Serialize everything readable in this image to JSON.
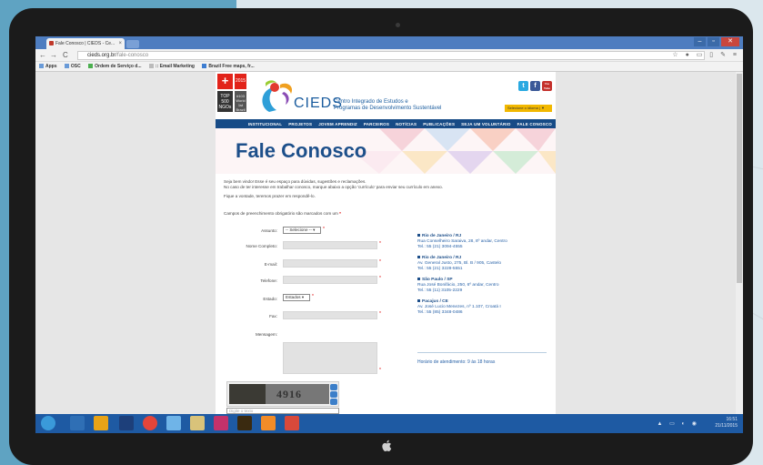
{
  "browser": {
    "tab_title": "Fale Conosco | CIEDS - Ce...",
    "url_domain": "cieds.org.br",
    "url_path": "/fale-conosco",
    "nav_back": "←",
    "nav_forward": "→",
    "nav_reload": "C",
    "window_min": "–",
    "window_max": "▫",
    "window_close": "✕",
    "toolbar_icons": "☆ ● ▭ ▯ ✎ ≡"
  },
  "bookmarks": [
    {
      "label": "Apps"
    },
    {
      "label": "OSC"
    },
    {
      "label": "Ordem de Serviço d..."
    },
    {
      "label": ":: Email Marketing"
    },
    {
      "label": "Brazil Free maps, fr..."
    }
  ],
  "site": {
    "badge_plus": "+",
    "badge_year": "2015",
    "badge_top": "TOP 500 NGOs",
    "badge_rank": "#103 World 1st Brazil",
    "logo_text": "CIEDS",
    "tagline_line1": "Centro Integrado de Estudos e",
    "tagline_line2": "Programas de Desenvolvimento Sustentável",
    "language_select": "Selecione o idioma | ▼",
    "social": [
      "t",
      "f",
      "You Tube"
    ],
    "menu": [
      "INSTITUCIONAL",
      "PROJETOS",
      "JOVEM APRENDIZ",
      "PARCEIROS",
      "NOTÍCIAS",
      "PUBLICAÇÕES",
      "SEJA UM VOLUNTÁRIO",
      "FALE CONOSCO"
    ],
    "page_title": "Fale Conosco",
    "intro_line1": "Seja bem vindo! Esse é seu espaço para dúvidas, sugestões e reclamações.",
    "intro_line2": "No caso de ter interesse em trabalhar conosco, marque abaixo a opção 'currículo' para enviar seu currículo em anexo.",
    "intro_line3": "Fique a vontade, teremos prazer em respondê-lo.",
    "required_note": "Campos de preenchimento obrigatório são marcados com um",
    "required_star": "*"
  },
  "form": {
    "assunto_label": "Assunto:",
    "assunto_value": "-- Selecione -- ▾",
    "nome_label": "Nome Completo:",
    "email_label": "E-mail:",
    "telefone_label": "Telefone:",
    "estado_label": "Estado:",
    "estado_value": "Estados ▾",
    "fax_label": "Fax:",
    "mensagem_label": "Mensagem:",
    "star": "*"
  },
  "addresses": [
    {
      "city": "Rio de Janeiro / RJ",
      "line": "Rua Conselheiro Saraiva, 28, 8º andar, Centro",
      "tel": "Tel.: 55 (21) 3094-4555"
    },
    {
      "city": "Rio de Janeiro / RJ",
      "line": "Av. General Justo, 275, Bl. B / 905, Castelo",
      "tel": "Tel.: 55 (21) 3228-5551"
    },
    {
      "city": "São Paulo / SP",
      "line": "Rua José Bonifácio, 250, 6º andar, Centro",
      "tel": "Tel.: 55 (11) 3105-2229"
    },
    {
      "city": "Pacajus / CE",
      "line": "Av. José Lucio Menezes, nº 1.107, Croatá I",
      "tel": "Tel.: 55 (85) 3348-0486"
    }
  ],
  "hours": "Horário de atendimento: 9 às 18 horas",
  "captcha": {
    "word": "4916",
    "input_placeholder": "Digite o texto"
  },
  "taskbar": {
    "time": "16:51",
    "date": "21/11/2015",
    "tray_icons": "▲ ▭ ◐ ◉"
  },
  "device": {
    "apple_logo": ""
  },
  "colors": {
    "navy": "#174b86",
    "accent_red": "#e2231a",
    "lang_yellow": "#f2b800",
    "taskbar_blue": "#1e5aa3"
  }
}
